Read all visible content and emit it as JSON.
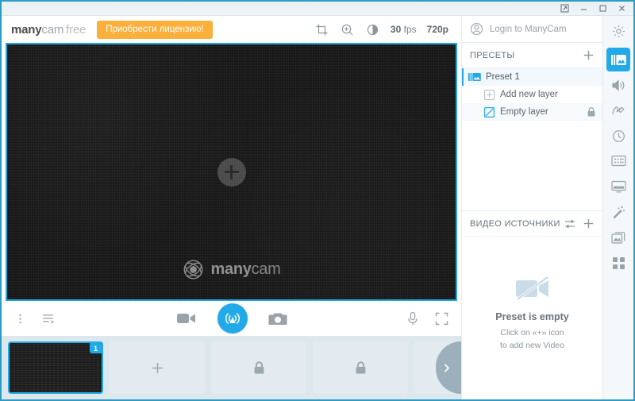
{
  "titlebar": {
    "restore_label": "⬈",
    "minimize_label": "—",
    "maximize_label": "▢",
    "close_label": "✕"
  },
  "header": {
    "logo_bold": "many",
    "logo_light": "cam",
    "logo_edition": "free",
    "buy_license": "Приобрести лицензию!",
    "crop_icon": "crop-icon",
    "zoom_icon": "zoom-in-icon",
    "brightness_icon": "brightness-icon",
    "fps_value": "30",
    "fps_unit": "fps",
    "resolution": "720p"
  },
  "stage": {
    "add_source_icon": "plus-icon",
    "watermark_bold": "many",
    "watermark_light": "cam"
  },
  "toolbar": {
    "menu_icon": "kebab-menu-icon",
    "playlist_icon": "playlist-icon",
    "record_icon": "video-record-icon",
    "broadcast_icon": "broadcast-icon",
    "snapshot_icon": "camera-snapshot-icon",
    "microphone_icon": "microphone-icon",
    "fullscreen_icon": "fullscreen-icon"
  },
  "strip": {
    "tiles": [
      {
        "type": "active",
        "badge": "1",
        "icon": ""
      },
      {
        "type": "add",
        "badge": "",
        "icon": "plus-icon"
      },
      {
        "type": "locked",
        "badge": "",
        "icon": "lock-icon"
      },
      {
        "type": "locked",
        "badge": "",
        "icon": "lock-icon"
      },
      {
        "type": "locked",
        "badge": "",
        "icon": "lock-icon"
      }
    ],
    "next_icon": "chevron-right-icon"
  },
  "rightpanel": {
    "login_label": "Login to ManyCam",
    "account_icon": "account-icon",
    "presets": {
      "title": "ПРЕСЕТЫ",
      "add_icon": "plus-icon",
      "preset_name": "Preset 1",
      "add_layer_label": "Add new layer",
      "empty_layer_label": "Empty layer",
      "lock_icon": "lock-icon"
    },
    "video_sources": {
      "title": "ВИДЕО ИСТОЧНИКИ",
      "settings_icon": "sliders-icon",
      "add_icon": "plus-icon",
      "empty_icon": "camera-off-icon",
      "empty_title": "Preset is empty",
      "empty_hint_line1": "Click on «+» icon",
      "empty_hint_line2": "to add new Video"
    }
  },
  "rail": {
    "items": [
      {
        "name": "settings",
        "icon": "gear-icon",
        "active": false
      },
      {
        "name": "presets",
        "icon": "presets-icon",
        "active": true
      },
      {
        "name": "audio",
        "icon": "speaker-icon",
        "active": false
      },
      {
        "name": "draw",
        "icon": "draw-icon",
        "active": false
      },
      {
        "name": "timer",
        "icon": "clock-icon",
        "active": false
      },
      {
        "name": "effects",
        "icon": "effects-icon",
        "active": false
      },
      {
        "name": "lower-third",
        "icon": "lower-third-icon",
        "active": false
      },
      {
        "name": "magic",
        "icon": "magic-wand-icon",
        "active": false
      },
      {
        "name": "backgrounds",
        "icon": "images-icon",
        "active": false
      },
      {
        "name": "apps",
        "icon": "grid-apps-icon",
        "active": false
      }
    ]
  },
  "colors": {
    "accent": "#22a9e8",
    "cta": "#fbb03b",
    "frame": "#2b9cc4",
    "strip_bg": "#dde7ee"
  }
}
